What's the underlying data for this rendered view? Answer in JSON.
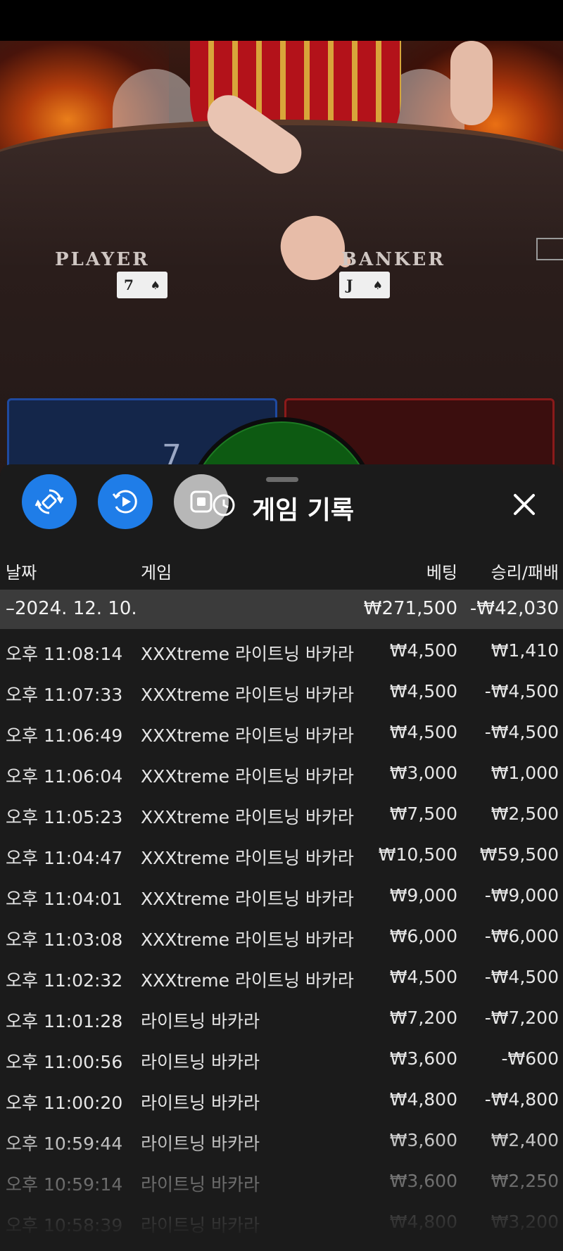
{
  "video": {
    "table_labels": {
      "player": "PLAYER",
      "banker": "BANKER"
    },
    "player_card": {
      "rank": "7",
      "suit": "♠"
    },
    "banker_card": {
      "rank": "J",
      "suit": "♠"
    },
    "player_score": "7"
  },
  "sheet": {
    "title": "게임 기록",
    "buttons": {
      "rotate_icon": "rotate-device-icon",
      "replay_icon": "replay-icon",
      "stop_icon": "stop-icon",
      "close_icon": "close-icon"
    },
    "columns": {
      "date": "날짜",
      "game": "게임",
      "bet": "베팅",
      "result": "승리/패배"
    },
    "date_group": {
      "date": "–2024. 12. 10.",
      "total_bet": "₩271,500",
      "total_result": "-₩42,030"
    },
    "rows": [
      {
        "time": "오후 11:08:14",
        "game": "XXXtreme 라이트닝 바카라",
        "bet": "₩4,500",
        "result": "₩1,410"
      },
      {
        "time": "오후 11:07:33",
        "game": "XXXtreme 라이트닝 바카라",
        "bet": "₩4,500",
        "result": "-₩4,500"
      },
      {
        "time": "오후 11:06:49",
        "game": "XXXtreme 라이트닝 바카라",
        "bet": "₩4,500",
        "result": "-₩4,500"
      },
      {
        "time": "오후 11:06:04",
        "game": "XXXtreme 라이트닝 바카라",
        "bet": "₩3,000",
        "result": "₩1,000"
      },
      {
        "time": "오후 11:05:23",
        "game": "XXXtreme 라이트닝 바카라",
        "bet": "₩7,500",
        "result": "₩2,500"
      },
      {
        "time": "오후 11:04:47",
        "game": "XXXtreme 라이트닝 바카라",
        "bet": "₩10,500",
        "result": "₩59,500"
      },
      {
        "time": "오후 11:04:01",
        "game": "XXXtreme 라이트닝 바카라",
        "bet": "₩9,000",
        "result": "-₩9,000"
      },
      {
        "time": "오후 11:03:08",
        "game": "XXXtreme 라이트닝 바카라",
        "bet": "₩6,000",
        "result": "-₩6,000"
      },
      {
        "time": "오후 11:02:32",
        "game": "XXXtreme 라이트닝 바카라",
        "bet": "₩4,500",
        "result": "-₩4,500"
      },
      {
        "time": "오후 11:01:28",
        "game": "라이트닝 바카라",
        "bet": "₩7,200",
        "result": "-₩7,200"
      },
      {
        "time": "오후 11:00:56",
        "game": "라이트닝 바카라",
        "bet": "₩3,600",
        "result": "-₩600"
      },
      {
        "time": "오후 11:00:20",
        "game": "라이트닝 바카라",
        "bet": "₩4,800",
        "result": "-₩4,800"
      },
      {
        "time": "오후 10:59:44",
        "game": "라이트닝 바카라",
        "bet": "₩3,600",
        "result": "₩2,400"
      },
      {
        "time": "오후 10:59:14",
        "game": "라이트닝 바카라",
        "bet": "₩3,600",
        "result": "₩2,250"
      },
      {
        "time": "오후 10:58:39",
        "game": "라이트닝 바카라",
        "bet": "₩4,800",
        "result": "₩3,200"
      }
    ]
  },
  "colors": {
    "accent_blue": "#1f7de8",
    "sheet_bg": "#1b1b1b",
    "date_row_bg": "#3b3b3b"
  }
}
